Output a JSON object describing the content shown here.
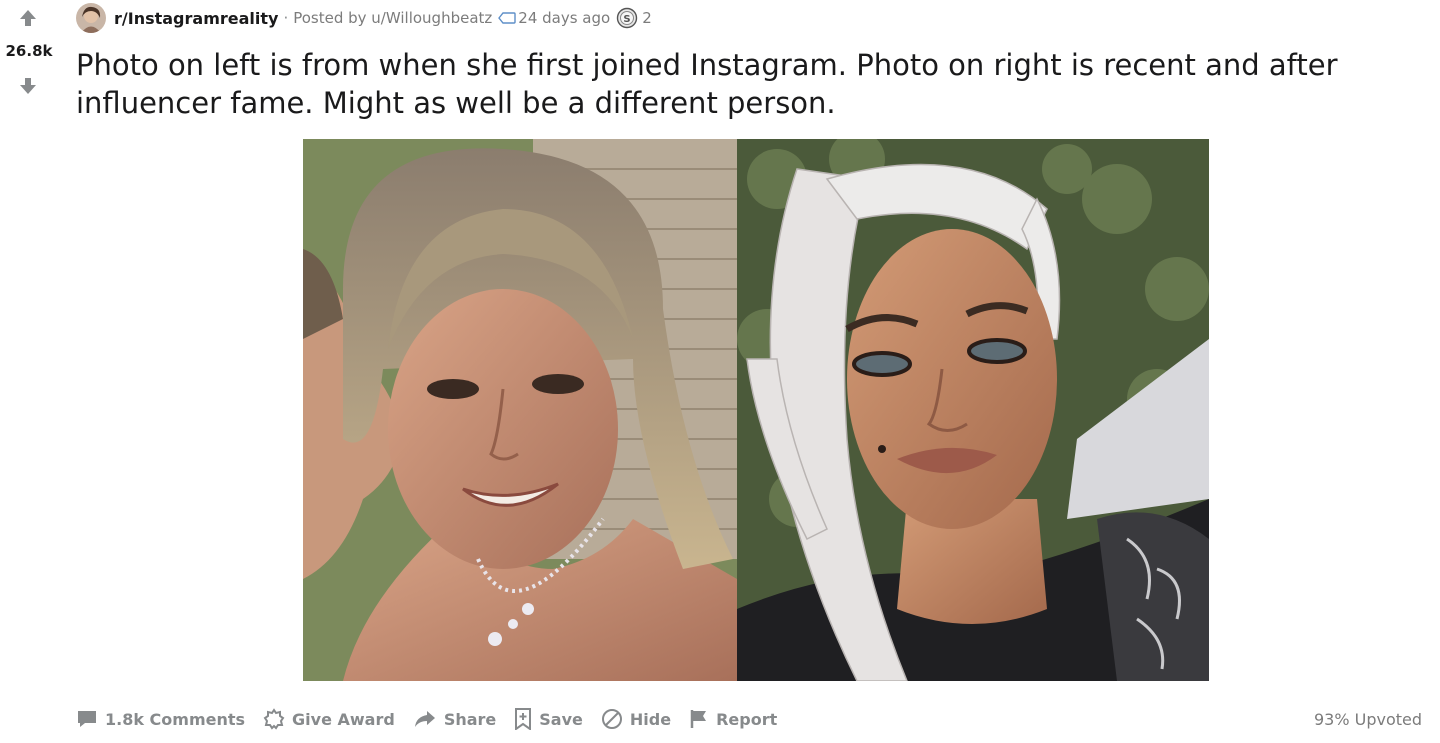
{
  "vote": {
    "score": "26.8k"
  },
  "meta": {
    "subreddit": "r/Instagramreality",
    "separator": "·",
    "posted_by": "Posted by u/Willoughbeatz",
    "age": "24 days ago",
    "award_count": "2"
  },
  "post": {
    "title": "Photo on left is from when she first joined Instagram. Photo on right is recent and after influencer fame. Might as well be a different person."
  },
  "actions": {
    "comments": "1.8k Comments",
    "give_award": "Give Award",
    "share": "Share",
    "save": "Save",
    "hide": "Hide",
    "report": "Report"
  },
  "upvote_ratio": "93% Upvoted",
  "icons": {
    "upvote": "upvote-arrow-icon",
    "downvote": "downvote-arrow-icon",
    "comments": "comment-bubble-icon",
    "award": "award-badge-icon",
    "share": "share-arrow-icon",
    "save": "bookmark-plus-icon",
    "hide": "hide-circle-slash-icon",
    "report": "flag-icon",
    "age": "clock-tag-icon",
    "award_meta": "silver-award-icon"
  },
  "colors": {
    "text": "#1a1a1b",
    "muted": "#878a8c",
    "meta": "#7c7c7c",
    "vote_arrow": "#878a8c"
  }
}
